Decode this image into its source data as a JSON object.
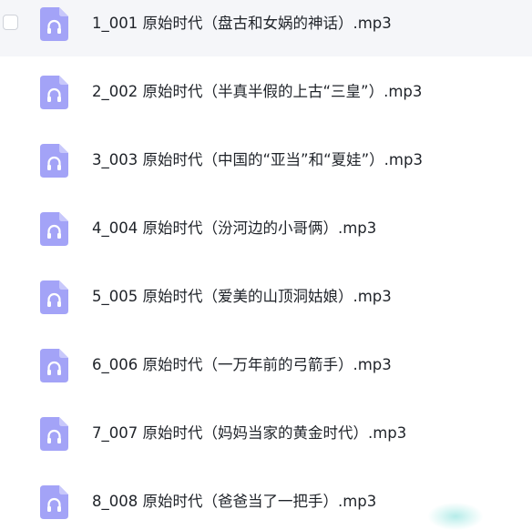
{
  "files": [
    {
      "name": "1_001 原始时代（盘古和女娲的神话）.mp3",
      "icon": "headphones-audio-file-icon"
    },
    {
      "name": "2_002 原始时代（半真半假的上古“三皇”）.mp3",
      "icon": "headphones-audio-file-icon"
    },
    {
      "name": "3_003 原始时代（中国的“亚当”和“夏娃”）.mp3",
      "icon": "headphones-audio-file-icon"
    },
    {
      "name": "4_004 原始时代（汾河边的小哥俩）.mp3",
      "icon": "headphones-audio-file-icon"
    },
    {
      "name": "5_005 原始时代（爱美的山顶洞姑娘）.mp3",
      "icon": "headphones-audio-file-icon"
    },
    {
      "name": "6_006 原始时代（一万年前的弓箭手）.mp3",
      "icon": "headphones-audio-file-icon"
    },
    {
      "name": "7_007 原始时代（妈妈当家的黄金时代）.mp3",
      "icon": "headphones-audio-file-icon"
    },
    {
      "name": "8_008 原始时代（爸爸当了一把手）.mp3",
      "icon": "headphones-audio-file-icon"
    }
  ],
  "colors": {
    "icon_fill": "#a3a3f7",
    "icon_fold": "#c8c8fb",
    "icon_glyph": "#ffffff",
    "row_hover_bg": "#f5f6f9",
    "text": "#1f2329",
    "checkbox_border": "#cfd2d9"
  }
}
